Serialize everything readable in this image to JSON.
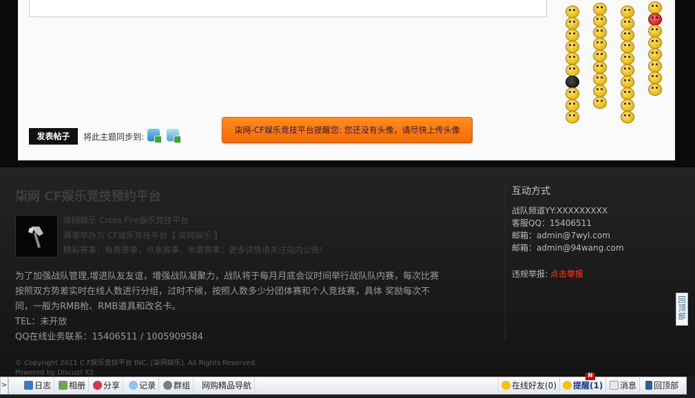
{
  "editor": {
    "post_button": "发表帖子",
    "sync_label": "将此主题同步到:",
    "avatar_notice": "柒网-CF娱乐竞技平台提醒您: 您还没有头像，请尽快上传头像"
  },
  "footer": {
    "site_title": "柒网 CF娱乐竞技预约平台",
    "info_lines": [
      "柒网娱乐    Cross Fire娱乐竞技平台",
      "赛事举办方    CF娱乐竞技平台【 柒网娱乐 】",
      "精彩赛事：每周赛事，月季赛事，年度赛事；更多详情请关注站内公告!"
    ],
    "notice_lines": [
      "为了加强战队管理,增进队友友谊，增强战队凝聚力，战队将于每月月底会议时间举行战队队内赛，每次比赛",
      "按照双方势差实时在线人数进行分组，过时不候，按照人数多少分团体赛和个人竞技赛，具体 奖励每次不",
      "同，一般为RMB枪、RMB道具和改名卡。",
      "TEL：未开放",
      "QQ在线业务联系：15406511 / 1005909584"
    ],
    "copyright": "© Copyright 2011 C F娱乐竞技平台 INC. [柒网娱乐]. All Rights Reserved.",
    "powered": "Powered by Discuz! X2"
  },
  "contact": {
    "title": "互动方式",
    "lines": [
      "战队频道YY:XXXXXXXXX",
      "客服QQ：15406511",
      "邮箱：admin@7wyl.com",
      "邮箱：admin@94wang.com"
    ],
    "report_label": "违规举报:",
    "report_link": "点击举报"
  },
  "side_back_top": "回顶部",
  "toolbar": {
    "toggle": ">",
    "left_items": [
      "日志",
      "相册",
      "分享",
      "记录",
      "群组",
      "网购精品导航"
    ],
    "online_friends": "在线好友(0)",
    "remind": "提醒(1)",
    "remind_badge": "N",
    "message": "消息",
    "back_top": "回顶部"
  }
}
